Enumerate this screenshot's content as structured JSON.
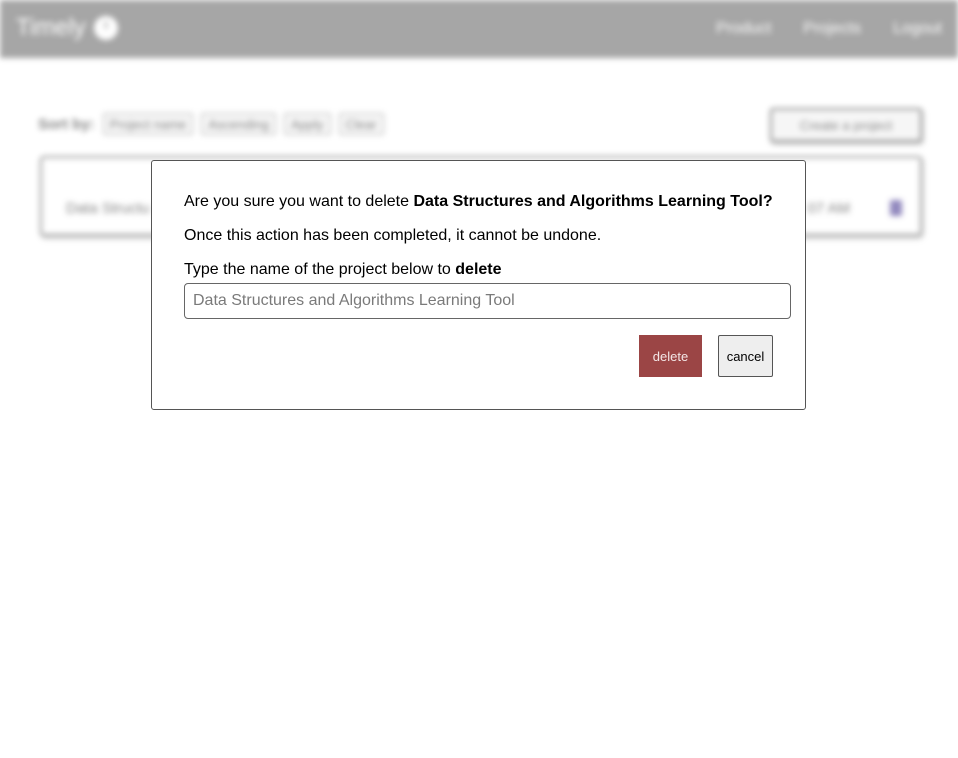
{
  "navbar": {
    "brand": "Timely",
    "links": [
      "Product",
      "Projects",
      "Logout"
    ]
  },
  "toolbar": {
    "sort_label": "Sort by:",
    "sort_field": "Project name",
    "sort_order": "Ascending",
    "apply_label": "Apply",
    "clear_label": "Clear",
    "create_label": "Create a project"
  },
  "project_card": {
    "name": "Data Structu",
    "time": "07 AM"
  },
  "modal": {
    "confirm_prefix": "Are you sure you want to delete ",
    "project_name": "Data Structures and Algorithms Learning Tool?",
    "warning": "Once this action has been completed, it cannot be undone.",
    "instruction_prefix": "Type the name of the project below to ",
    "instruction_action": "delete",
    "input_placeholder": "Data Structures and Algorithms Learning Tool",
    "delete_label": "delete",
    "cancel_label": "cancel"
  },
  "colors": {
    "navbar": "#5e5e5e",
    "delete_button": "#9b4545"
  }
}
